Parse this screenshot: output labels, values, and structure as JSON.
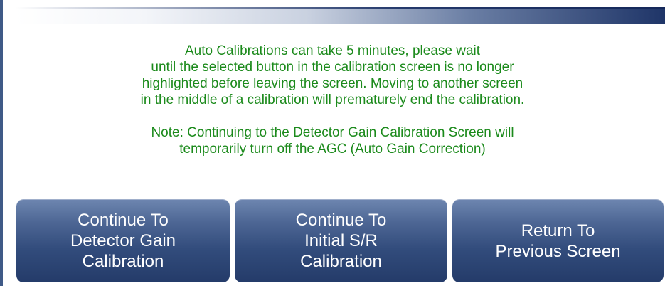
{
  "message": {
    "paragraph": "Auto Calibrations can take 5 minutes, please wait\nuntil the selected button in the calibration screen is no longer\nhighlighted before leaving the screen. Moving to another screen\nin the middle of a calibration will prematurely end the calibration.",
    "note": "Note: Continuing to the Detector Gain Calibration Screen will\ntemporarily turn off the AGC (Auto Gain Correction)"
  },
  "buttons": {
    "detector_gain": "Continue To\nDetector Gain\nCalibration",
    "initial_sr": "Continue To\nInitial S/R\nCalibration",
    "return": "Return To\nPrevious Screen"
  },
  "colors": {
    "message_text": "#1b8a1b",
    "button_top": "#6e86b0",
    "button_bottom": "#243b69",
    "header_dark": "#1f3568"
  }
}
